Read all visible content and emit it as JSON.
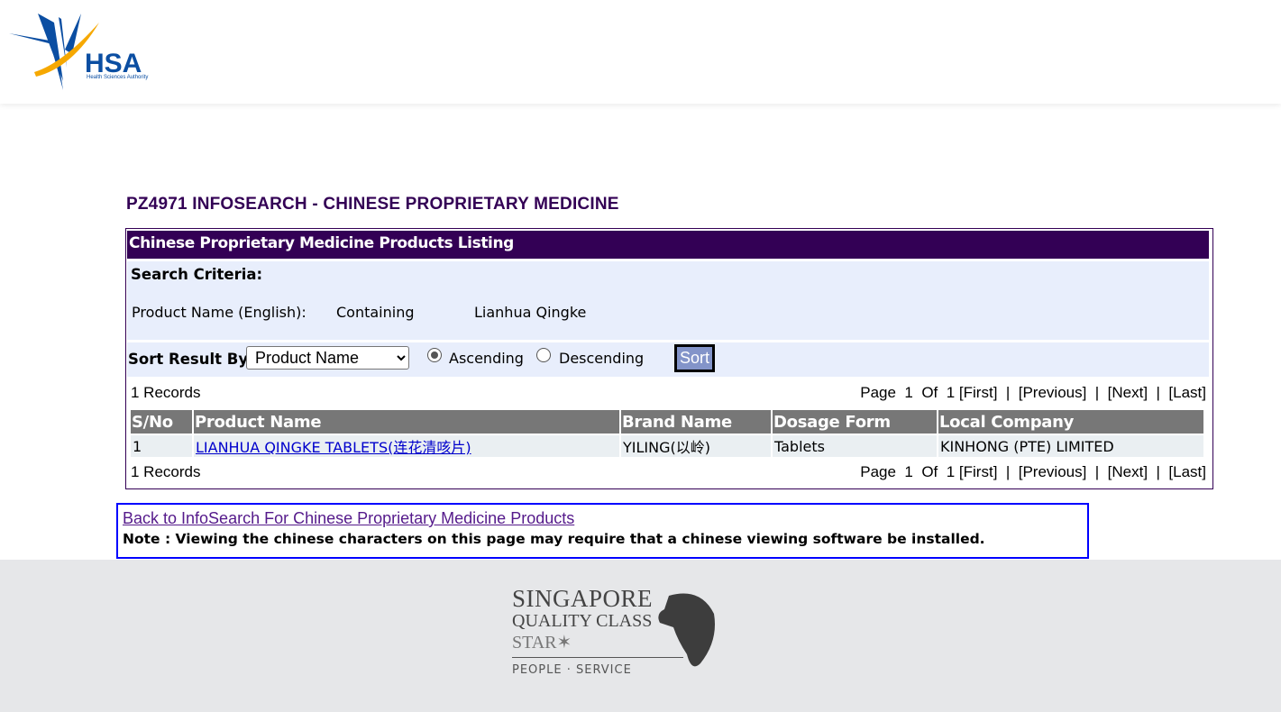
{
  "header": {
    "logo_text": "HSA",
    "logo_subtext": "Health Sciences Authority"
  },
  "page_title": "PZ4971 INFOSEARCH - CHINESE PROPRIETARY MEDICINE",
  "listing": {
    "heading": "Chinese Proprietary Medicine Products Listing",
    "criteria_label": "Search Criteria:",
    "criteria": {
      "field": "Product Name (English):",
      "operator": "Containing",
      "value": "Lianhua Qingke"
    },
    "sort": {
      "label": "Sort Result By:",
      "selected": "Product Name",
      "ascending": "Ascending",
      "descending": "Descending",
      "order": "Ascending",
      "button": "Sort"
    },
    "records": "1 Records",
    "pagination": {
      "page_label": "Page",
      "current": "1",
      "of_label": "Of",
      "total": "1",
      "first": "[First]",
      "previous": "[Previous]",
      "next": "[Next]",
      "last": "[Last]",
      "sep": "|"
    },
    "columns": [
      "S/No",
      "Product Name",
      "Brand Name",
      "Dosage Form",
      "Local Company"
    ],
    "rows": [
      [
        "1",
        "LIANHUA QINGKE TABLETS(连花清咳片)",
        "YILING(以岭)",
        "Tablets",
        "KINHONG (PTE) LIMITED"
      ]
    ]
  },
  "note": {
    "back_link": "Back to InfoSearch For Chinese Proprietary Medicine Products",
    "text": "Note : Viewing the chinese characters on this page may require that a chinese viewing software be installed."
  },
  "footer": {
    "logo_lines": [
      "SINGAPORE",
      "QUALITY CLASS",
      "STAR",
      "PEOPLE · SERVICE"
    ]
  },
  "colors": {
    "primary": "#330055",
    "criteria_bg": "#e8eefc",
    "header_cell": "#777777",
    "link": "#0000cc"
  }
}
